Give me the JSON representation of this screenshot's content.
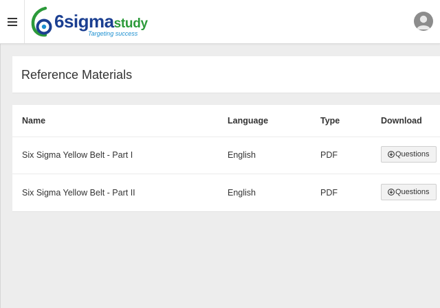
{
  "header": {
    "logo_word_main": "6sigma",
    "logo_word_sub": "study",
    "logo_tagline": "Targeting success"
  },
  "page": {
    "title": "Reference Materials"
  },
  "table": {
    "columns": [
      "Name",
      "Language",
      "Type",
      "Download"
    ],
    "rows": [
      {
        "name": "Six Sigma Yellow Belt - Part I",
        "language": "English",
        "type": "PDF",
        "download_label": "Questions"
      },
      {
        "name": "Six Sigma Yellow Belt - Part II",
        "language": "English",
        "type": "PDF",
        "download_label": "Questions"
      }
    ]
  },
  "icons": {
    "menu": "hamburger-icon",
    "avatar": "user-avatar-icon",
    "download": "circle-arrow-down-icon"
  },
  "colors": {
    "brand_blue": "#1b3f91",
    "brand_green": "#2c9a3a",
    "tagline_blue": "#1b8fd0",
    "page_background": "#ededed"
  }
}
